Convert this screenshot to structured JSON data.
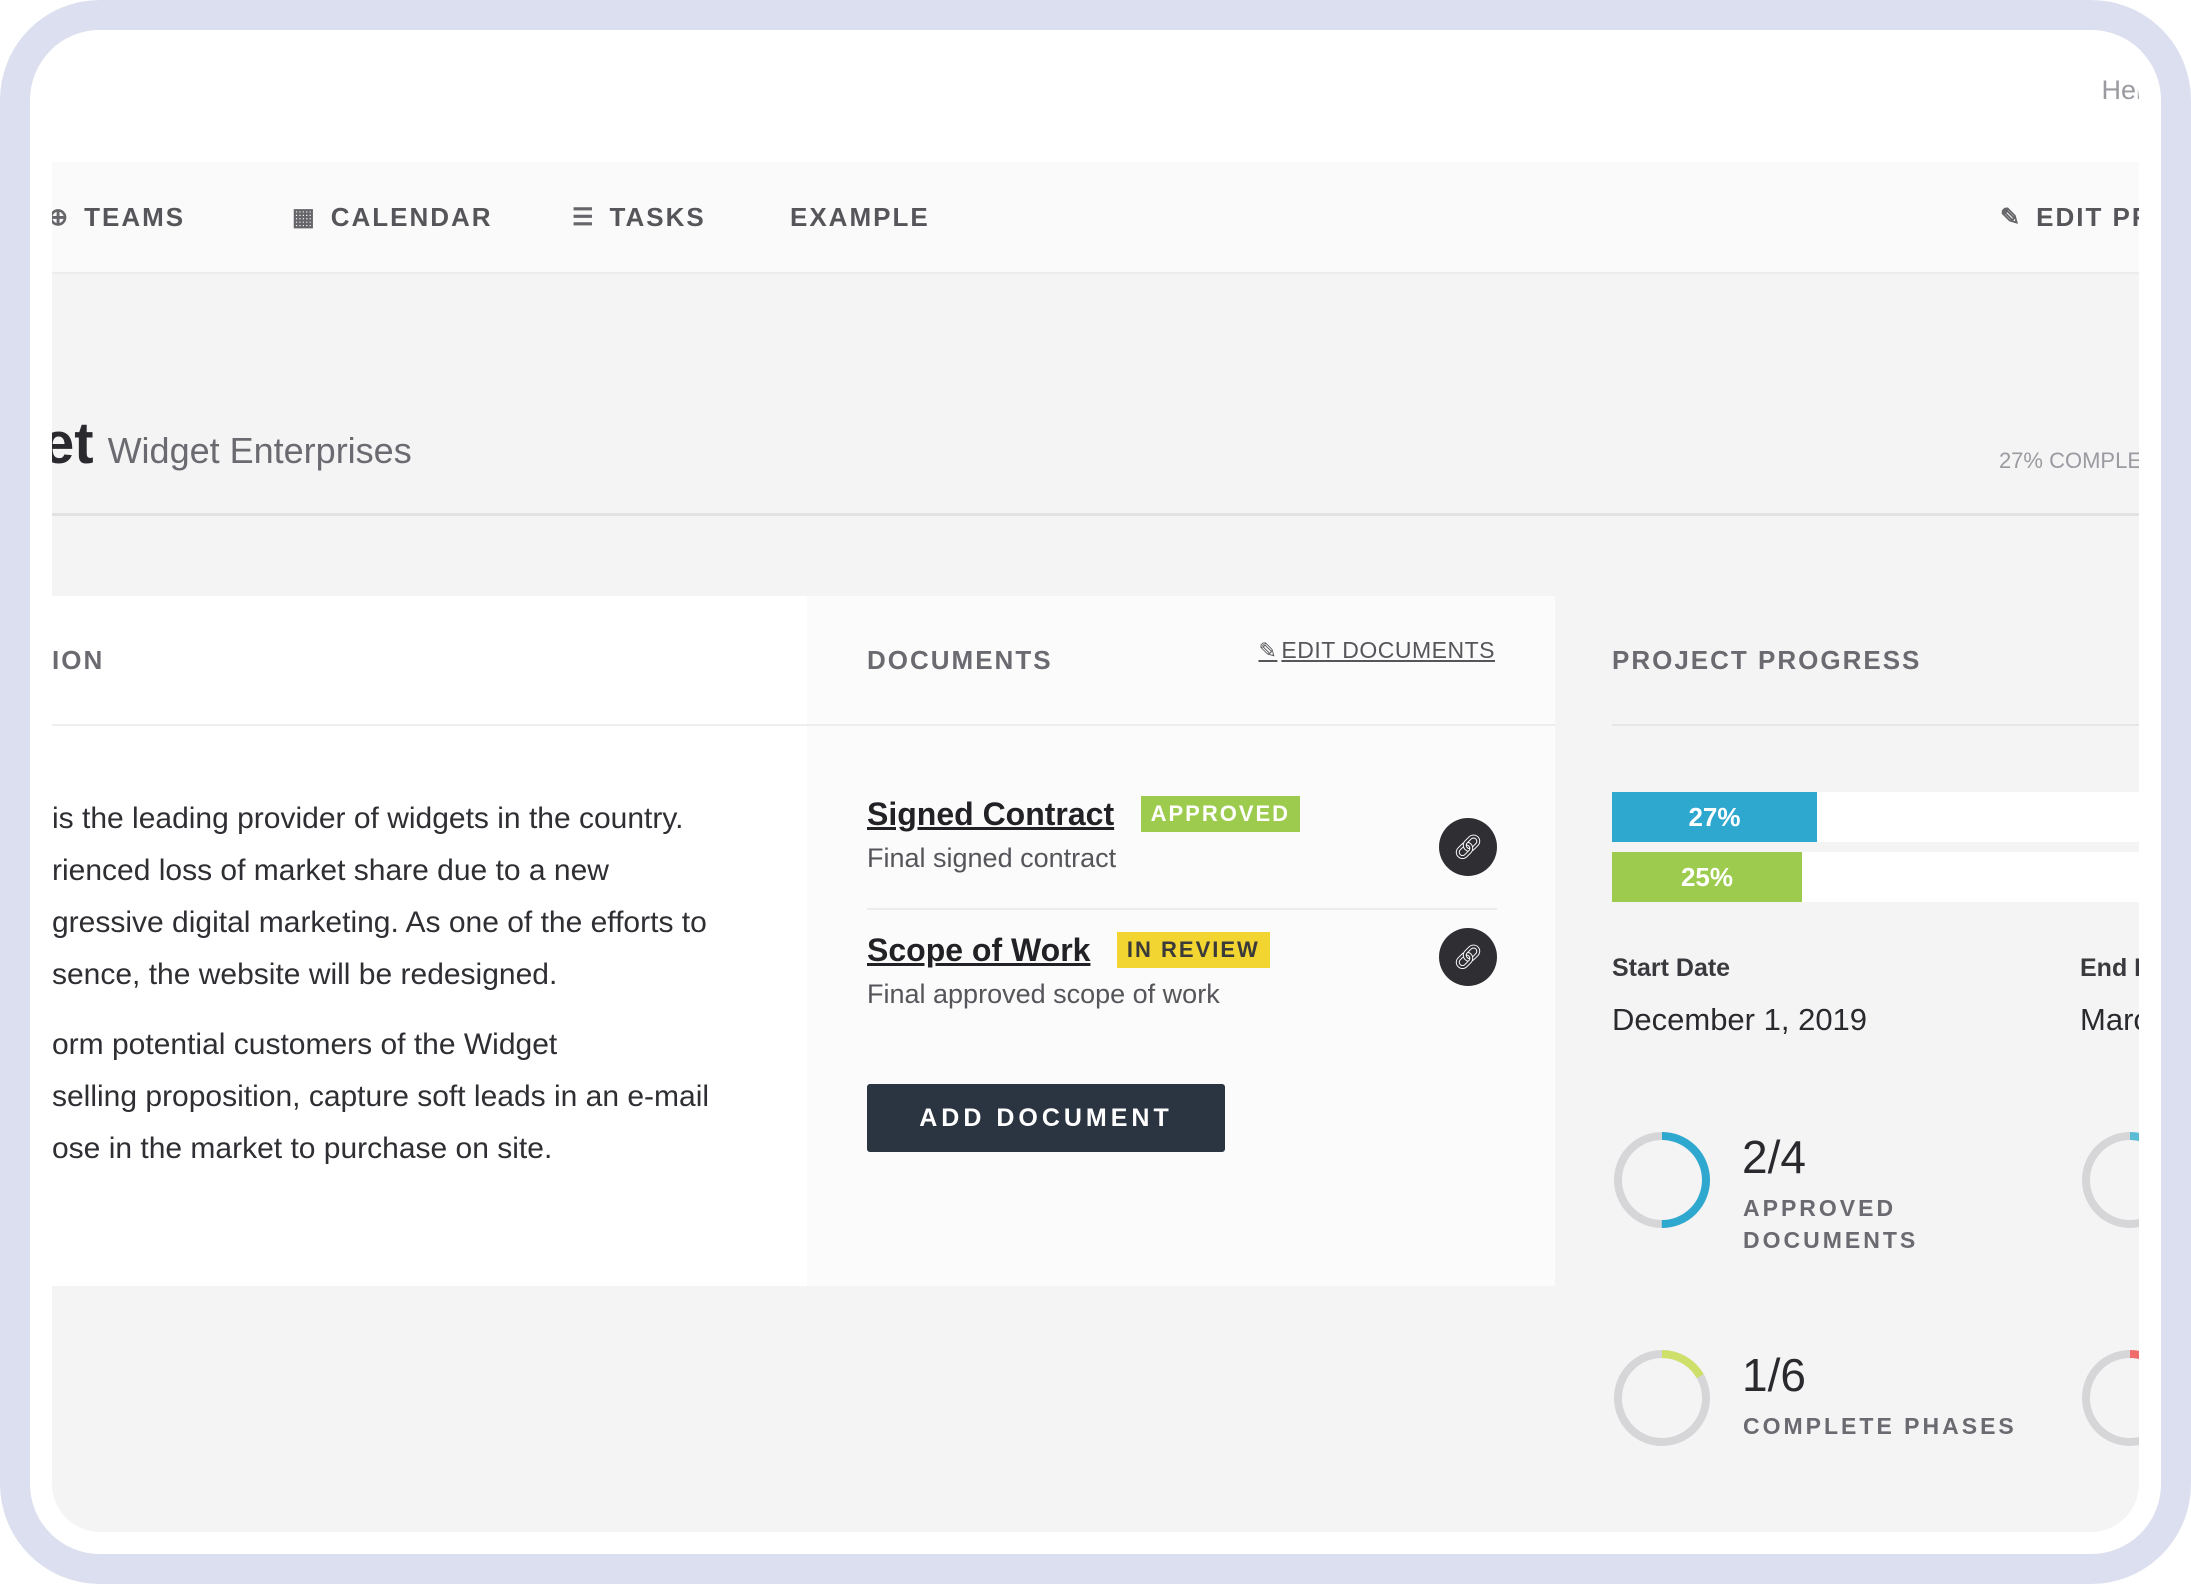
{
  "topbar": {
    "greeting": "Hel"
  },
  "nav": {
    "teams": "TEAMS",
    "calendar": "CALENDAR",
    "tasks": "TASKS",
    "example": "EXAMPLE",
    "edit_project": "EDIT PROJ"
  },
  "header": {
    "title_fragment": "et",
    "company": "Widget Enterprises",
    "completion": "27% COMPLE"
  },
  "about": {
    "heading": "ION",
    "lines": [
      "is the leading provider of widgets in the country.",
      "rienced loss of market share due to a new",
      "gressive digital marketing. As one of the efforts to",
      "sence, the website will be redesigned.",
      "orm potential customers of the Widget",
      "selling proposition, capture soft leads in an e-mail",
      "ose in the market to purchase on site."
    ]
  },
  "documents": {
    "heading": "DOCUMENTS",
    "edit_label": "EDIT DOCUMENTS",
    "items": [
      {
        "title": "Signed Contract",
        "status": "APPROVED",
        "subtitle": "Final signed contract"
      },
      {
        "title": "Scope of Work",
        "status": "IN REVIEW",
        "subtitle": "Final approved scope of work"
      }
    ],
    "add_label": "ADD DOCUMENT"
  },
  "progress": {
    "heading": "PROJECT PROGRESS",
    "bars": [
      {
        "label": "27%",
        "fraction": 0.27,
        "color": "#2fa8d0"
      },
      {
        "label": "25%",
        "fraction": 0.25,
        "color": "#9ccb4e"
      }
    ],
    "start_label": "Start Date",
    "start_value": "December 1, 2019",
    "end_label": "End Da",
    "end_value": "March",
    "stats": [
      {
        "value": "2/4",
        "label_line1": "APPROVED",
        "label_line2": "DOCUMENTS",
        "fraction": 0.5,
        "color": "#2fa8d0"
      },
      {
        "value": "1/6",
        "label_line1": "COMPLETE PHASES",
        "label_line2": "",
        "fraction": 0.167,
        "color": "#cfe06a"
      }
    ],
    "partial_donuts": [
      {
        "color": "#5bbcd6"
      },
      {
        "color": "#f06b6b"
      }
    ]
  },
  "colors": {
    "accent_blue": "#2fa8d0",
    "accent_green": "#9ccb4e",
    "review_yellow": "#f2d531",
    "dark_button": "#2b3441"
  }
}
